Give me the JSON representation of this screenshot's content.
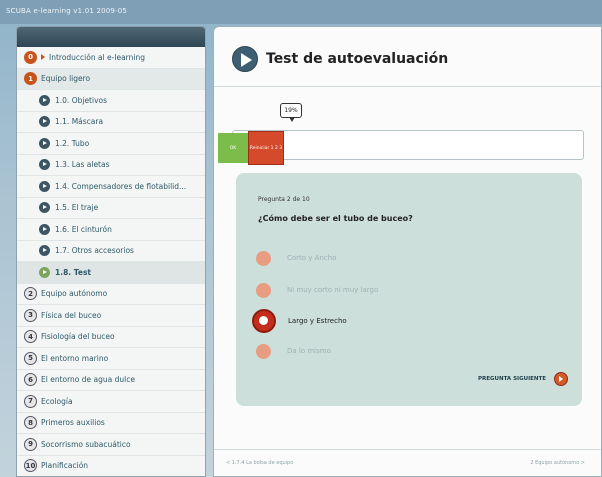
{
  "window": {
    "title": "SCUBA e-learning v1.01 2009-05"
  },
  "sidebar": {
    "items": [
      {
        "number": "0",
        "label": "Introducción al e-learning",
        "level": 1,
        "state": "normal",
        "arrow": true
      },
      {
        "number": "1",
        "label": "Equipo ligero",
        "level": 1,
        "state": "expanded"
      },
      {
        "label": "1.0. Objetivos",
        "level": 2
      },
      {
        "label": "1.1. Máscara",
        "level": 2
      },
      {
        "label": "1.2. Tubo",
        "level": 2
      },
      {
        "label": "1.3. Las aletas",
        "level": 2
      },
      {
        "label": "1.4. Compensadores de flotabilid...",
        "level": 2
      },
      {
        "label": "1.5. El traje",
        "level": 2
      },
      {
        "label": "1.6. El cinturón",
        "level": 2
      },
      {
        "label": "1.7. Otros accesorios",
        "level": 2
      },
      {
        "label": "1.8. Test",
        "level": 2,
        "state": "current"
      },
      {
        "number": "2",
        "label": "Equipo autónomo",
        "level": 1
      },
      {
        "number": "3",
        "label": "Física del buceo",
        "level": 1
      },
      {
        "number": "4",
        "label": "Fisiología del buceo",
        "level": 1
      },
      {
        "number": "5",
        "label": "El entorno marino",
        "level": 1
      },
      {
        "number": "6",
        "label": "El entorno de agua dulce",
        "level": 1
      },
      {
        "number": "7",
        "label": "Ecología",
        "level": 1
      },
      {
        "number": "8",
        "label": "Primeros auxilios",
        "level": 1
      },
      {
        "number": "9",
        "label": "Socorrismo subacuático",
        "level": 1
      },
      {
        "number": "10",
        "label": "Planificación",
        "level": 1
      }
    ]
  },
  "main": {
    "title": "Test de autoevaluación",
    "progress": {
      "percent_label": "19%",
      "percent": 19,
      "ok_label": "OK",
      "restart_label": "Reiniciar 1 2 3"
    },
    "question": {
      "counter": "Pregunta 2 de 10",
      "text": "¿Cómo debe ser el tubo de buceo?",
      "options": [
        {
          "label": "Corto y Ancho",
          "selected": false
        },
        {
          "label": "Ni muy corto ni muy largo",
          "selected": false
        },
        {
          "label": "Largo y Estrecho",
          "selected": true
        },
        {
          "label": "Da lo mismo",
          "selected": false
        }
      ],
      "next_label": "PREGUNTA SIGUIENTE"
    },
    "footer": {
      "prev_link": "< 1.7.4 La bolsa de equipo",
      "next_link": "2 Equipo autónomo >"
    }
  },
  "colors": {
    "accent": "#c8541c",
    "nav_text": "#2d5966",
    "card_bg": "#cddfdb",
    "ok_green": "#7cbc4a",
    "restart_red": "#d64a2c"
  },
  "icons": {
    "header": "play-circle-icon",
    "submodule": "play-circle-icon",
    "next": "arrow-right-circle-icon"
  }
}
